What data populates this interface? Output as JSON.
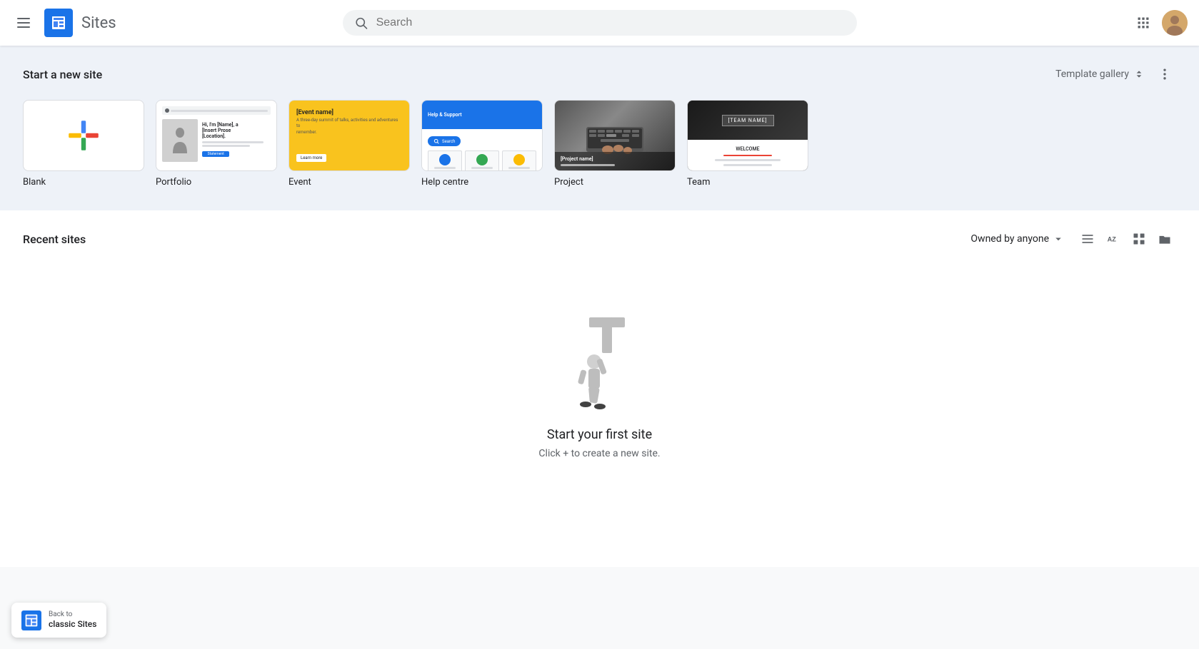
{
  "app": {
    "title": "Sites"
  },
  "header": {
    "search_placeholder": "Search",
    "hamburger_label": "Main menu",
    "grid_apps_label": "Google apps",
    "avatar_label": "Account"
  },
  "template_section": {
    "title": "Start a new site",
    "gallery_btn": "Template gallery",
    "more_btn": "More options",
    "templates": [
      {
        "id": "blank",
        "label": "Blank"
      },
      {
        "id": "portfolio",
        "label": "Portfolio"
      },
      {
        "id": "event",
        "label": "Event"
      },
      {
        "id": "help",
        "label": "Help centre"
      },
      {
        "id": "project",
        "label": "Project"
      },
      {
        "id": "team",
        "label": "Team"
      }
    ]
  },
  "recent_section": {
    "title": "Recent sites",
    "owned_by": "Owned by anyone",
    "empty_title": "Start your first site",
    "empty_subtitle": "Click + to create a new site."
  },
  "back_to_classic": {
    "line1": "Back to",
    "line2": "classic Sites"
  }
}
